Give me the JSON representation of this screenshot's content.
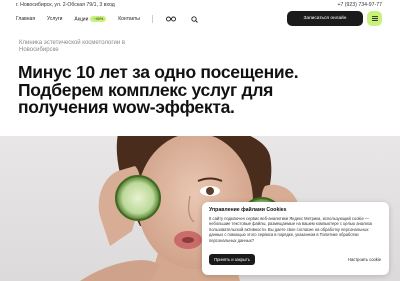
{
  "topbar": {
    "address": "г. Новосибирск, ул. 2-Обская 79/1, 3 вход",
    "phone": "+7 (923) 734-97-77"
  },
  "nav": {
    "items": [
      {
        "label": "Главная"
      },
      {
        "label": "Услуги"
      },
      {
        "label": "Акции",
        "badge": "−40%"
      },
      {
        "label": "Контакты"
      }
    ],
    "cta_label": "Записаться онлайн"
  },
  "hero": {
    "clinic": "Клиника эстетической косметологии в Новосибирске",
    "headline": "Минус 10 лет за одно посещение. Подберем комплекс услуг для получения wow-эффекта."
  },
  "cookie": {
    "title": "Управление файлами Cookies",
    "text": "К сайту подключен сервис веб-аналитики Яндекс Метрика, использующий cookie — небольшие текстовые файлы, размещаемые на вашем компьютере с целью анализа пользовательской активности. Вы даете свое согласие на обработку персональных данных с помощью этого сервиса в порядке, указанном в Политике обработки персональных данных?",
    "accept_label": "Принять и закрыть",
    "settings_label": "Настроить cookie"
  },
  "colors": {
    "accent": "#c9f27a",
    "dark": "#1b1b1b"
  }
}
